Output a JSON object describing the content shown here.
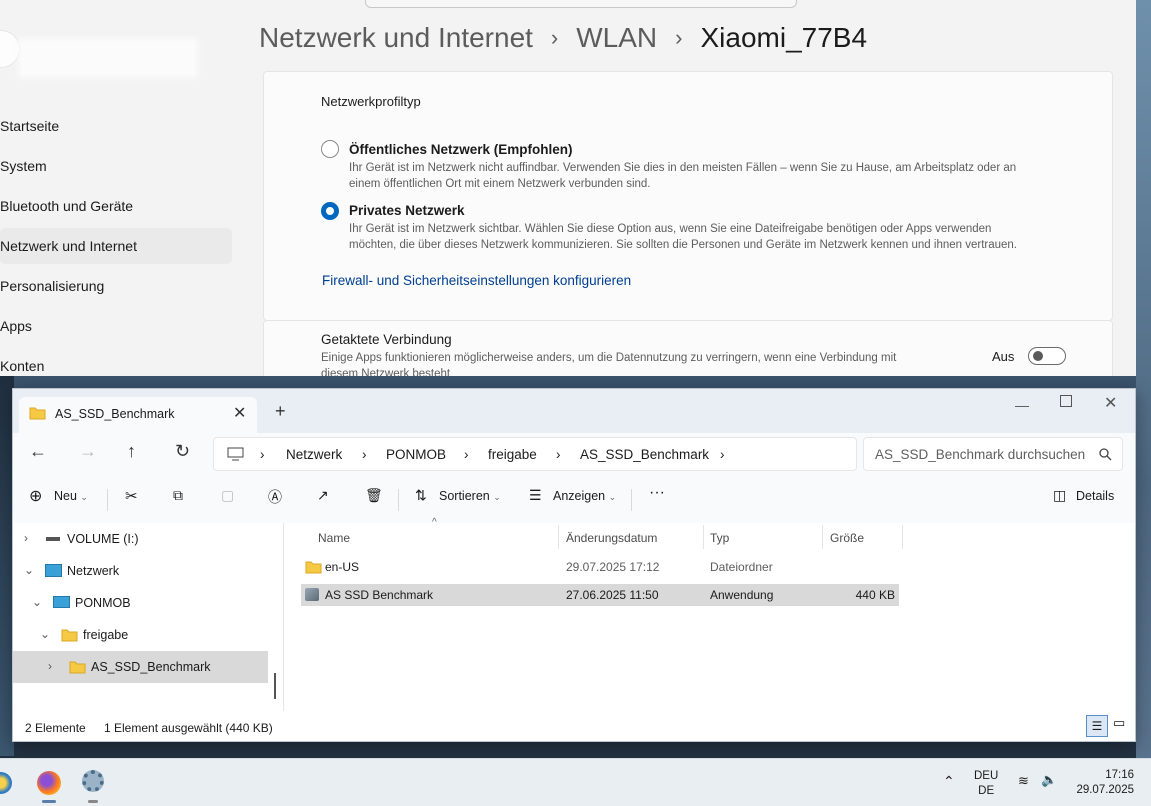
{
  "settings": {
    "breadcrumb": {
      "part1": "Netzwerk und Internet",
      "part2": "WLAN",
      "current": "Xiaomi_77B4"
    },
    "nav": [
      "Startseite",
      "System",
      "Bluetooth und Geräte",
      "Netzwerk und Internet",
      "Personalisierung",
      "Apps",
      "Konten"
    ],
    "profile": {
      "title": "Netzwerkprofiltyp",
      "public_label": "Öffentliches Netzwerk (Empfohlen)",
      "public_desc_1": "Ihr Gerät ist im Netzwerk nicht auffindbar. Verwenden Sie dies in den meisten Fällen – wenn Sie zu Hause, am Arbeitsplatz oder an",
      "public_desc_2": "einem öffentlichen Ort mit einem Netzwerk verbunden sind.",
      "private_label": "Privates Netzwerk",
      "private_desc_1": "Ihr Gerät ist im Netzwerk sichtbar. Wählen Sie diese Option aus, wenn Sie eine Dateifreigabe benötigen oder Apps verwenden",
      "private_desc_2": "möchten, die über dieses Netzwerk kommunizieren. Sie sollten die Personen und Geräte im Netzwerk kennen und ihnen vertrauen.",
      "selected": "private",
      "firewall_link": "Firewall- und Sicherheitseinstellungen konfigurieren"
    },
    "metered": {
      "title": "Getaktete Verbindung",
      "desc_1": "Einige Apps funktionieren möglicherweise anders, um die Datennutzung zu verringern, wenn eine Verbindung mit",
      "desc_2": "diesem Netzwerk besteht",
      "state": "Aus"
    }
  },
  "explorer": {
    "tab_title": "AS_SSD_Benchmark",
    "address": [
      "Netzwerk",
      "PONMOB",
      "freigabe",
      "AS_SSD_Benchmark"
    ],
    "search_placeholder": "AS_SSD_Benchmark durchsuchen",
    "toolbar": {
      "new": "Neu",
      "sort": "Sortieren",
      "view": "Anzeigen",
      "details": "Details"
    },
    "tree": [
      {
        "label": "VOLUME (I:)"
      },
      {
        "label": "Netzwerk"
      },
      {
        "label": "PONMOB"
      },
      {
        "label": "freigabe"
      },
      {
        "label": "AS_SSD_Benchmark"
      }
    ],
    "columns": [
      "Name",
      "Änderungsdatum",
      "Typ",
      "Größe"
    ],
    "files": [
      {
        "name": "en-US",
        "date": "29.07.2025 17:12",
        "type": "Dateiordner",
        "size": ""
      },
      {
        "name": "AS SSD Benchmark",
        "date": "27.06.2025 11:50",
        "type": "Anwendung",
        "size": "440 KB"
      }
    ],
    "status": {
      "count": "2 Elemente",
      "selection": "1 Element ausgewählt (440 KB)"
    }
  },
  "taskbar": {
    "lang_1": "DEU",
    "lang_2": "DE",
    "time": "17:16",
    "date": "29.07.2025"
  }
}
